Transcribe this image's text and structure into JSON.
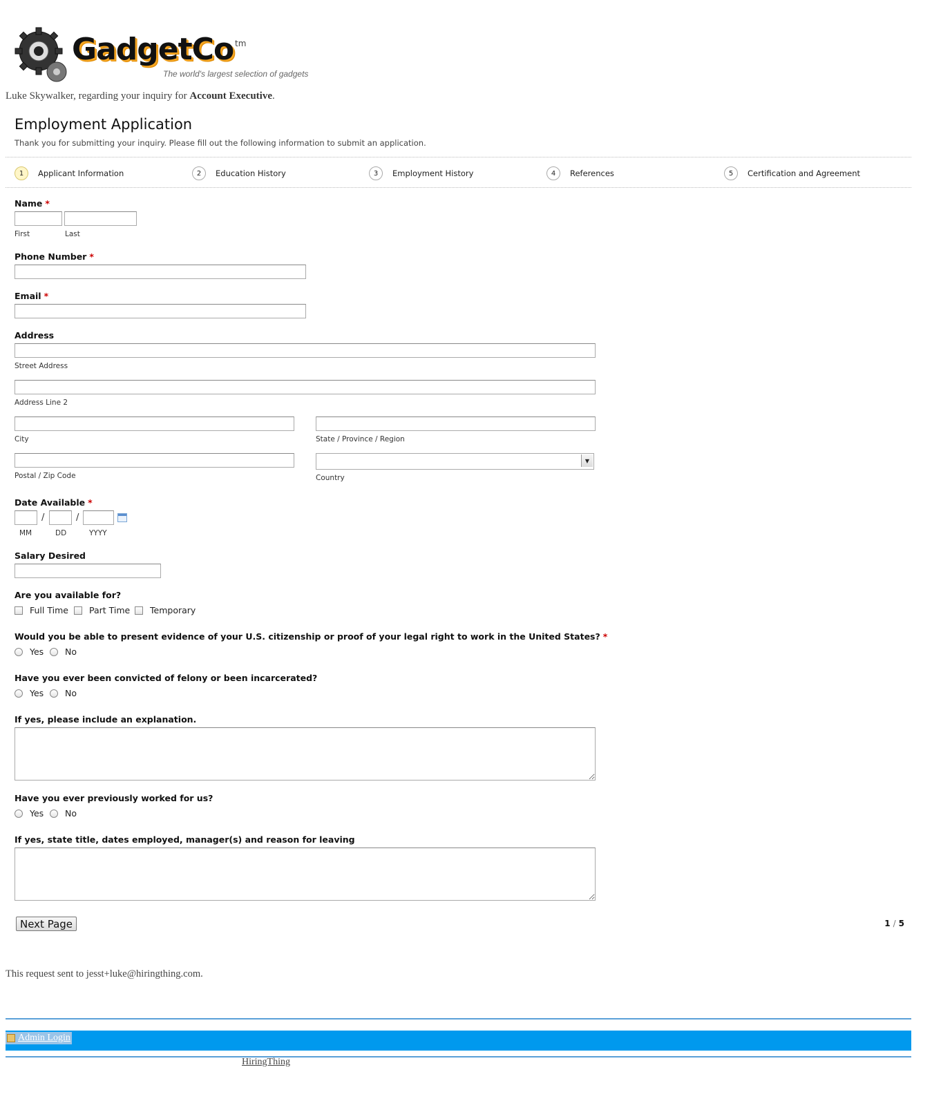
{
  "brand": {
    "name": "GadgetCo",
    "tm": "tm",
    "tagline": "The world's largest selection of gadgets"
  },
  "greeting": {
    "prefix": "Luke Skywalker, regarding your inquiry for ",
    "position": "Account Executive",
    "suffix": "."
  },
  "form": {
    "title": "Employment Application",
    "description": "Thank you for submitting your inquiry. Please fill out the following information to submit an application."
  },
  "steps": [
    {
      "num": "1",
      "label": "Applicant Information"
    },
    {
      "num": "2",
      "label": "Education History"
    },
    {
      "num": "3",
      "label": "Employment History"
    },
    {
      "num": "4",
      "label": "References"
    },
    {
      "num": "5",
      "label": "Certification and Agreement"
    }
  ],
  "fields": {
    "name": {
      "label": "Name",
      "first": "First",
      "last": "Last"
    },
    "phone": {
      "label": "Phone Number"
    },
    "email": {
      "label": "Email"
    },
    "address": {
      "label": "Address",
      "street": "Street Address",
      "line2": "Address Line 2",
      "city": "City",
      "state": "State / Province / Region",
      "postal": "Postal / Zip Code",
      "country": "Country"
    },
    "date": {
      "label": "Date Available",
      "mm": "MM",
      "dd": "DD",
      "yyyy": "YYYY",
      "sep": "/"
    },
    "salary": {
      "label": "Salary Desired"
    },
    "availability": {
      "label": "Are you available for?",
      "options": [
        "Full Time",
        "Part Time",
        "Temporary"
      ]
    },
    "citizenship": {
      "label": "Would you be able to present evidence of your U.S. citizenship or proof of your legal right to work in the United States?",
      "yes": "Yes",
      "no": "No"
    },
    "felony": {
      "label": "Have you ever been convicted of felony or been incarcerated?",
      "yes": "Yes",
      "no": "No"
    },
    "explanation": {
      "label": "If yes, please include an explanation."
    },
    "previous": {
      "label": "Have you ever previously worked for us?",
      "yes": "Yes",
      "no": "No"
    },
    "previous_details": {
      "label": "If yes, state title, dates employed, manager(s) and reason for leaving"
    },
    "required_mark": "*"
  },
  "nav": {
    "next": "Next Page",
    "page_current": "1",
    "page_sep": "/",
    "page_total": "5"
  },
  "footer": {
    "sent_to": "This request sent to jesst+luke@hiringthing.com.",
    "admin": "Admin Login",
    "credit": "HiringThing"
  }
}
